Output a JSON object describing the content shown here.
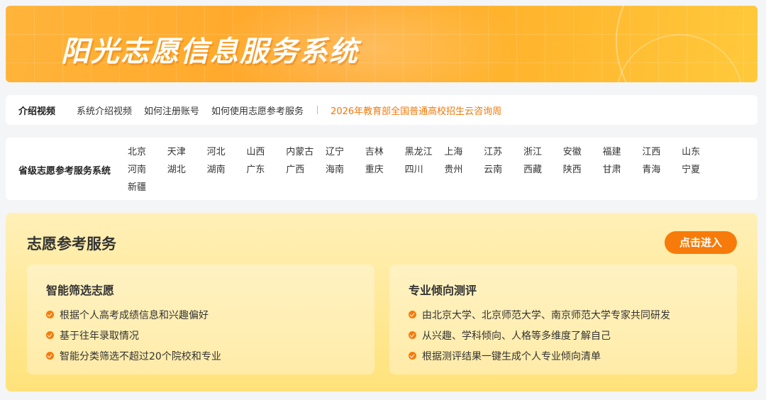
{
  "banner": {
    "title": "阳光志愿信息服务系统"
  },
  "video_bar": {
    "label": "介绍视频",
    "links": [
      "系统介绍视频",
      "如何注册账号",
      "如何使用志愿参考服务"
    ],
    "highlight": "2026年教育部全国普通高校招生云咨询周"
  },
  "provinces": {
    "label": "省级志愿参考服务系统",
    "items": [
      "北京",
      "天津",
      "河北",
      "山西",
      "内蒙古",
      "辽宁",
      "吉林",
      "黑龙江",
      "上海",
      "江苏",
      "浙江",
      "安徽",
      "福建",
      "江西",
      "山东",
      "河南",
      "湖北",
      "湖南",
      "广东",
      "广西",
      "海南",
      "重庆",
      "四川",
      "贵州",
      "云南",
      "西藏",
      "陕西",
      "甘肃",
      "青海",
      "宁夏",
      "新疆"
    ]
  },
  "service": {
    "title": "志愿参考服务",
    "enter_label": "点击进入",
    "cards": [
      {
        "title": "智能筛选志愿",
        "items": [
          "根据个人高考成绩信息和兴趣偏好",
          "基于往年录取情况",
          "智能分类筛选不超过20个院校和专业"
        ]
      },
      {
        "title": "专业倾向测评",
        "items": [
          "由北京大学、北京师范大学、南京师范大学专家共同研发",
          "从兴趣、学科倾向、人格等多维度了解自己",
          "根据测评结果一键生成个人专业倾向清单"
        ]
      }
    ]
  },
  "colors": {
    "accent": "#f77b0a",
    "highlight_text": "#f0780a"
  }
}
